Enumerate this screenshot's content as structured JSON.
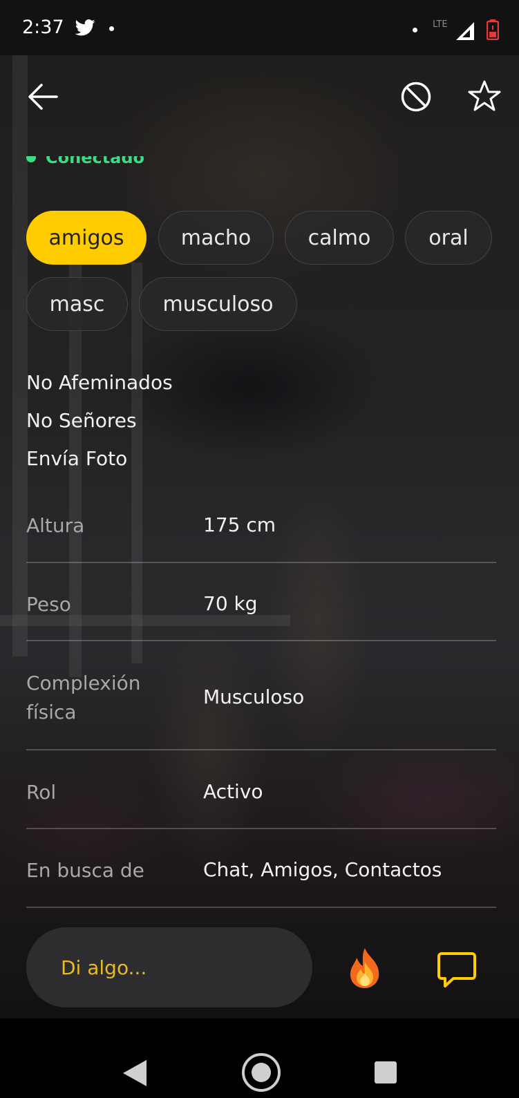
{
  "status_bar": {
    "time": "2:37",
    "network": "LTE",
    "icons": [
      "twitter-icon",
      "notification-dot",
      "signal-icon",
      "battery-low-icon"
    ]
  },
  "toolbar": {
    "back_icon": "arrow-left",
    "block_icon": "block-circle",
    "favorite_icon": "star-outline"
  },
  "profile": {
    "online_status": "Conectado",
    "online_color": "#3ddc84",
    "tags": [
      {
        "label": "amigos",
        "active": true
      },
      {
        "label": "macho",
        "active": false
      },
      {
        "label": "calmo",
        "active": false
      },
      {
        "label": "oral",
        "active": false
      },
      {
        "label": "masc",
        "active": false
      },
      {
        "label": "musculoso",
        "active": false
      }
    ],
    "about_lines": [
      "No Afeminados",
      "No Señores",
      "Envía Foto"
    ],
    "stats": [
      {
        "label": "Altura",
        "value": "175 cm"
      },
      {
        "label": "Peso",
        "value": "70 kg"
      },
      {
        "label": "Complexión física",
        "value": "Musculoso"
      },
      {
        "label": "Rol",
        "value": "Activo"
      },
      {
        "label": "En busca de",
        "value": "Chat, Amigos, Contactos"
      }
    ]
  },
  "message_bar": {
    "placeholder": "Di algo...",
    "tap_icon": "fire-icon",
    "chat_icon": "chat-bubble-icon"
  },
  "nav_bar": {
    "icons": [
      "nav-back-icon",
      "nav-home-icon",
      "nav-recents-icon"
    ]
  },
  "colors": {
    "accent": "#ffcc00",
    "placeholder_text": "#e9bb20",
    "tag_bg": "#2a2a2c"
  }
}
